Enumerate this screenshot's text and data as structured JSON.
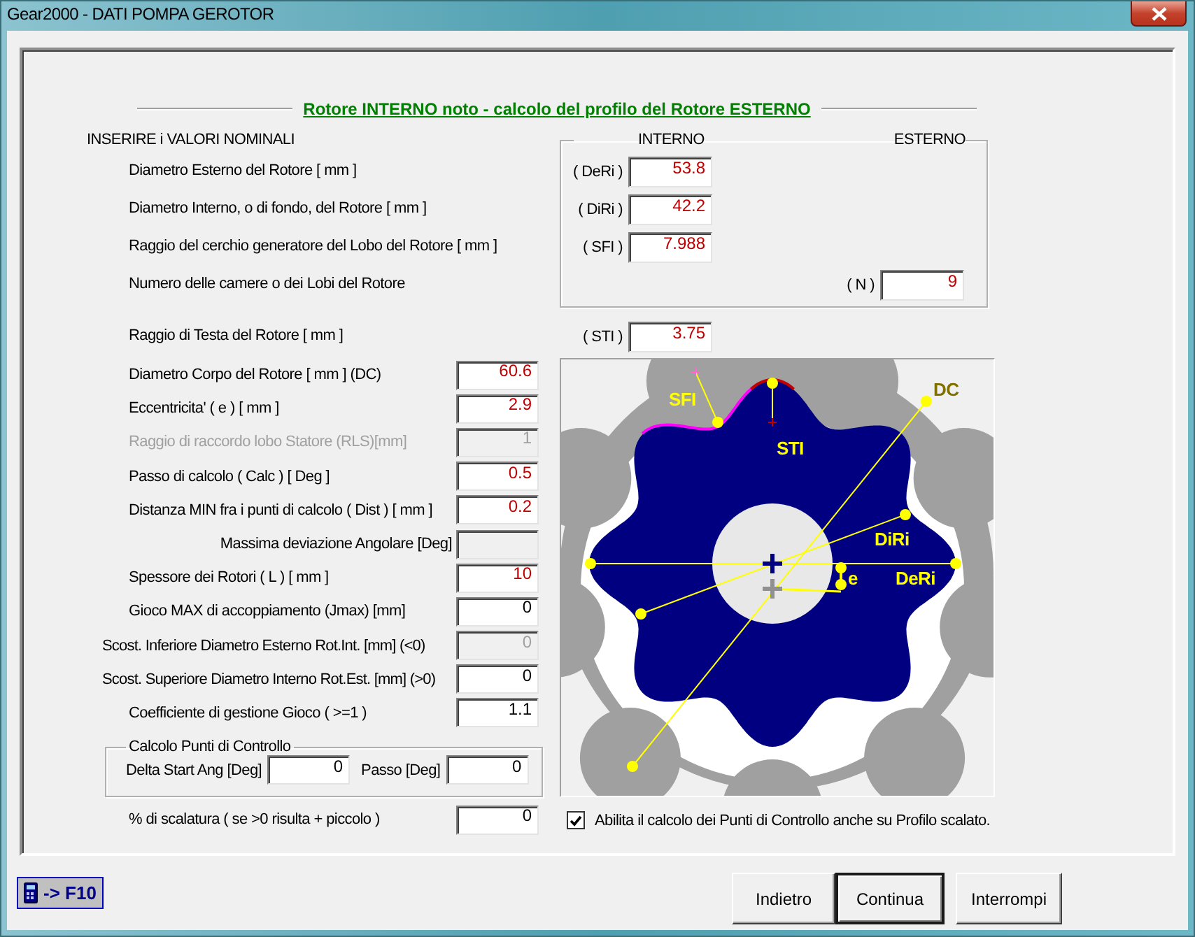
{
  "window": {
    "title": "Gear2000 - DATI POMPA GEROTOR"
  },
  "header": {
    "title": "Rotore INTERNO noto - calcolo del profilo del Rotore ESTERNO"
  },
  "nominal": {
    "heading": "INSERIRE i VALORI NOMINALI",
    "columns": [
      "INTERNO",
      "ESTERNO"
    ],
    "rows": [
      {
        "label": "Diametro Esterno del Rotore [ mm ]",
        "tag": "( DeRi )",
        "value": "53.8",
        "highlighted": true,
        "kind": "inner"
      },
      {
        "label": "Diametro Interno, o di fondo, del Rotore [ mm ]",
        "tag": "( DiRi )",
        "value": "42.2",
        "highlighted": true,
        "kind": "inner"
      },
      {
        "label": "Raggio del cerchio generatore del Lobo del Rotore [ mm ]",
        "tag": "( SFI )",
        "value": "7.988",
        "highlighted": true,
        "kind": "inner"
      },
      {
        "label": "Numero delle camere o dei Lobi del Rotore",
        "tag": "( N )",
        "value": "9",
        "highlighted": true,
        "kind": "outer"
      }
    ]
  },
  "head_radius": {
    "label": "Raggio di Testa del Rotore [ mm ]",
    "tag": "( STI )",
    "value": "3.75",
    "highlighted": true
  },
  "parameters": [
    {
      "kind": "standard",
      "label": "Diametro Corpo del Rotore [ mm ] (DC)",
      "value": "60.6",
      "highlighted": true,
      "disabled": false
    },
    {
      "kind": "standard",
      "label": "Eccentricita'  ( e ) [ mm ]",
      "value": "2.9",
      "highlighted": true,
      "disabled": false
    },
    {
      "kind": "standard",
      "label": "Raggio di raccordo lobo Statore (RLS)[mm]",
      "value": "1",
      "highlighted": false,
      "disabled": true
    },
    {
      "kind": "standard",
      "label": "Passo di calcolo ( Calc ) [ Deg ]",
      "value": "0.5",
      "highlighted": true,
      "disabled": false
    },
    {
      "kind": "standard",
      "label": "Distanza MIN fra i punti di calcolo ( Dist ) [ mm ]",
      "value": "0.2",
      "highlighted": true,
      "disabled": false
    },
    {
      "kind": "derived",
      "label": "Massima deviazione Angolare [Deg]",
      "highlighted": false,
      "disabled": true
    },
    {
      "kind": "standard",
      "label": "Spessore dei Rotori ( L ) [ mm ]",
      "value": "10",
      "highlighted": true,
      "disabled": false
    },
    {
      "kind": "standard",
      "label": "Gioco MAX di accoppiamento (Jmax) [mm]",
      "value": "0",
      "highlighted": false,
      "disabled": false
    },
    {
      "kind": "tolerance",
      "label": "Scost. Inferiore Diametro Esterno Rot.Int. [mm] (<0)",
      "value": "0",
      "highlighted": false,
      "disabled": true
    },
    {
      "kind": "tolerance",
      "label": "Scost. Superiore Diametro Interno Rot.Est. [mm] (>0)",
      "value": "0",
      "highlighted": false,
      "disabled": false
    },
    {
      "kind": "standard",
      "label": "Coefficiente di gestione Gioco ( >=1 )",
      "value": "1.1",
      "highlighted": false,
      "disabled": false
    }
  ],
  "control_points": {
    "title": "Calcolo Punti di Controllo",
    "fields": [
      {
        "label": "Delta Start Ang [Deg]",
        "value": "0"
      },
      {
        "label": "Passo [Deg]",
        "value": "0"
      }
    ]
  },
  "scaling": {
    "label": "% di scalatura ( se >0 risulta + piccolo )",
    "value": "0"
  },
  "drawing": {
    "labels": [
      "SFI",
      "STI",
      "DC",
      "DiRi",
      "DeRi",
      "e"
    ]
  },
  "scaled_option": {
    "label": "Abilita il calcolo dei Punti di Controllo anche su Profilo scalato.",
    "checked": true
  },
  "calculator": {
    "label": "-> F10"
  },
  "buttons": [
    {
      "label": "Indietro",
      "default": false
    },
    {
      "label": "Continua",
      "default": true
    },
    {
      "label": "Interrompi",
      "default": false
    }
  ]
}
